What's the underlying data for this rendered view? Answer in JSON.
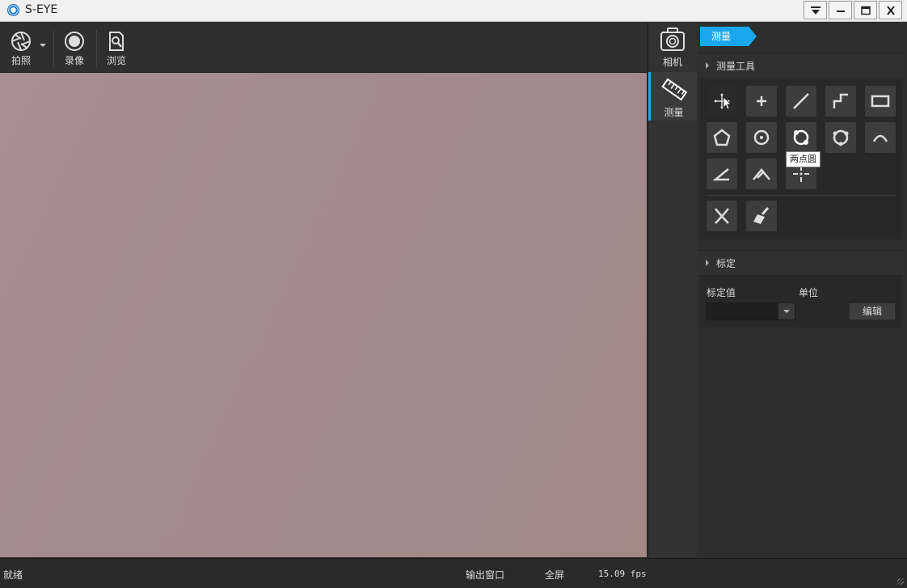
{
  "window": {
    "title": "S-EYE",
    "controls": [
      "menu-dropdown-icon",
      "minimize-icon",
      "maximize-icon",
      "close-icon"
    ]
  },
  "toolbar": {
    "snapshot_label": "拍照",
    "record_label": "录像",
    "browse_label": "浏览"
  },
  "nav": {
    "items": [
      {
        "label": "相机",
        "icon": "camera-icon",
        "active": false
      },
      {
        "label": "测量",
        "icon": "ruler-icon",
        "active": true
      }
    ]
  },
  "panel": {
    "tab_label": "测量",
    "measure_tools_title": "测量工具",
    "tools": [
      "select-move-icon",
      "point-icon",
      "line-icon",
      "polyline-icon",
      "rectangle-icon",
      "polygon-icon",
      "center-circle-icon",
      "two-point-circle-icon",
      "three-point-circle-icon",
      "arc-icon",
      "angle-icon",
      "four-point-angle-icon",
      "crosshair-icon",
      "delete-measure-icon",
      "clear-all-icon"
    ],
    "tooltip": "两点圆",
    "calibration_title": "标定",
    "calibration_value_label": "标定值",
    "unit_label": "单位",
    "calibration_value": "",
    "edit_label": "编辑"
  },
  "status": {
    "text": "就绪",
    "output_window": "输出窗口",
    "fullscreen": "全屏",
    "fps": "15.09 fps"
  },
  "colors": {
    "accent": "#19a8f0",
    "background": "#2b2b2b",
    "video": "#a48b90"
  }
}
